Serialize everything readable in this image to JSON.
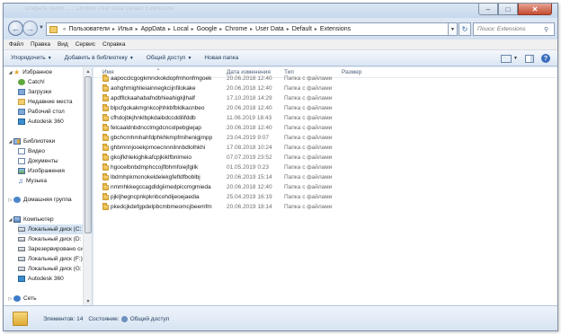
{
  "window": {
    "title": "Открыть папку ... : Chrome User Data Default Extensions"
  },
  "address": {
    "crumbs": [
      "Пользователи",
      "Илья",
      "AppData",
      "Local",
      "Google",
      "Chrome",
      "User Data",
      "Default",
      "Extensions"
    ],
    "search_placeholder": "Поиск: Extensions"
  },
  "menu": [
    "Файл",
    "Правка",
    "Вид",
    "Сервис",
    "Справка"
  ],
  "toolbar": {
    "organize": "Упорядочить",
    "add_library": "Добавить в библиотеку",
    "share": "Общий доступ",
    "new_folder": "Новая папка"
  },
  "nav": {
    "favorites": "Избранное",
    "catch": "Catch!",
    "downloads": "Загрузки",
    "recent": "Недавние места",
    "desktop": "Рабочий стол",
    "autodesk": "Autodesk 360",
    "libraries": "Библиотеки",
    "video": "Видео",
    "documents": "Документы",
    "images": "Изображения",
    "music": "Музыка",
    "homegroup": "Домашняя группа",
    "computer": "Компьютер",
    "disk_c": "Локальный диск (C:",
    "disk_d": "Локальный диск (D:",
    "reserved": "Зарезервировано си",
    "disk_f": "Локальный диск (F:)",
    "disk_g": "Локальный диск (G:",
    "autodesk2": "Autodesk 360",
    "network": "Сеть"
  },
  "columns": {
    "name": "Имя",
    "date": "Дата изменения",
    "type": "Тип",
    "size": "Размер"
  },
  "files": [
    {
      "name": "aapocclcgogkmnckokdopfmhonfmgoek",
      "date": "20.06.2018 12:40",
      "type": "Папка с файлами"
    },
    {
      "name": "aohghmighlieiainnegkcijnfilokake",
      "date": "20.06.2018 12:40",
      "type": "Папка с файлами"
    },
    {
      "name": "apdfllckaahabafndbhieahigkjlhalf",
      "date": "17.10.2018 14:29",
      "type": "Папка с файлами"
    },
    {
      "name": "blpcfgokakmgnkcojhhkbfbldkacnbeo",
      "date": "20.06.2018 12:40",
      "type": "Папка с файлами"
    },
    {
      "name": "cfhdojbkjhnklbpkdaibdccddilifddb",
      "date": "11.06.2019 18:43",
      "type": "Папка с файлами"
    },
    {
      "name": "felcaaldnbdncclmgdcncolpebgiejap",
      "date": "20.06.2018 12:40",
      "type": "Папка с файлами"
    },
    {
      "name": "gbchcmhmhahfdphkhkmpfmihenigjmpp",
      "date": "23.04.2019 9:07",
      "type": "Папка с файлами"
    },
    {
      "name": "ghbmnnjooekpmoecnnnilnnbdlolhkhi",
      "date": "17.08.2018 10:24",
      "type": "Папка с файлами"
    },
    {
      "name": "gkojfkhlekighikafcpjkiklfbnlmeio",
      "date": "07.07.2019 23:52",
      "type": "Папка с файлами"
    },
    {
      "name": "hgocelbnbdmphccojflbhmfoiejfgilk",
      "date": "01.05.2019 0:23",
      "type": "Папка с файлами"
    },
    {
      "name": "lbdmhpkmonokeldelekgfefldfboblbj",
      "date": "20.06.2019 15:14",
      "type": "Папка с файлами"
    },
    {
      "name": "nmmhkkegccagdldgiimedpiccmgmieda",
      "date": "20.06.2018 12:40",
      "type": "Папка с файлами"
    },
    {
      "name": "pjkljhegncpnkpknbcohdijeoejaedia",
      "date": "25.04.2019 16:19",
      "type": "Папка с файлами"
    },
    {
      "name": "pkedcjkdefgpdelpbcmbmeomcjbeemfm",
      "date": "20.06.2019 18:14",
      "type": "Папка с файлами"
    }
  ],
  "status": {
    "count": "Элементов: 14",
    "state_label": "Состояние:",
    "state_value": "Общий доступ"
  },
  "icons": {
    "favorites": "star-icon",
    "folder": "folder-icon",
    "computer": "computer-icon",
    "disk": "disk-icon",
    "network": "network-icon"
  },
  "colors": {
    "selection": "#d5e3f3",
    "folder": "#f0cd6a",
    "toolbar_text": "#1e395b"
  }
}
